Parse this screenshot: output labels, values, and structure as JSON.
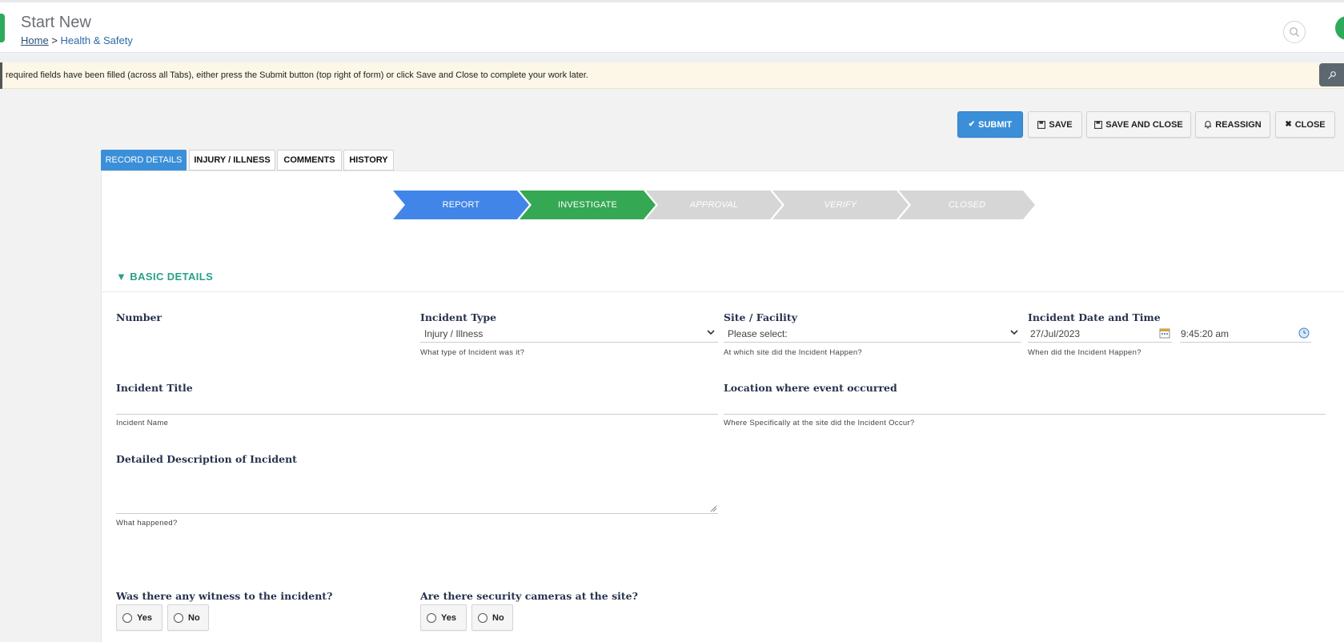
{
  "header": {
    "title": "Start New",
    "breadcrumb": {
      "home": "Home",
      "separator": ">",
      "current": "Health & Safety"
    }
  },
  "notice": {
    "text": "required fields have been filled (across all Tabs), either press the Submit button (top right of form) or click Save and Close to complete your work later."
  },
  "actions": {
    "submit": "SUBMIT",
    "save": "SAVE",
    "save_and_close": "SAVE AND CLOSE",
    "reassign": "REASSIGN",
    "close": "CLOSE"
  },
  "tabs": [
    {
      "label": "RECORD DETAILS",
      "active": true
    },
    {
      "label": "INJURY / ILLNESS",
      "active": false
    },
    {
      "label": "COMMENTS",
      "active": false
    },
    {
      "label": "HISTORY",
      "active": false
    }
  ],
  "stages": [
    {
      "label": "REPORT",
      "status": "complete",
      "color": "#4285e8"
    },
    {
      "label": "INVESTIGATE",
      "status": "current",
      "color": "#34a853"
    },
    {
      "label": "APPROVAL",
      "status": "pending",
      "color": "#d6d6d6"
    },
    {
      "label": "VERIFY",
      "status": "pending",
      "color": "#d6d6d6"
    },
    {
      "label": "CLOSED",
      "status": "pending",
      "color": "#d6d6d6"
    }
  ],
  "section": {
    "title": "BASIC DETAILS",
    "toggle": "▼"
  },
  "fields": {
    "number": {
      "label": "Number"
    },
    "incident_type": {
      "label": "Incident Type",
      "value": "Injury / Illness",
      "help": "What type of Incident was it?"
    },
    "site": {
      "label": "Site / Facility",
      "value": "Please select:",
      "help": "At which site did the Incident Happen?"
    },
    "date_time": {
      "label": "Incident Date and Time",
      "date": "27/Jul/2023",
      "time": "9:45:20 am",
      "help": "When did the Incident Happen?"
    },
    "title": {
      "label": "Incident Title",
      "value": "",
      "help": "Incident Name"
    },
    "location": {
      "label": "Location where event occurred",
      "value": "",
      "help": "Where Specifically at the site did the Incident Occur?"
    },
    "description": {
      "label": "Detailed Description of Incident",
      "value": "",
      "help": "What happened?"
    },
    "witness": {
      "label": "Was there any witness to the incident?",
      "yes": "Yes",
      "no": "No"
    },
    "cameras": {
      "label": "Are there security cameras at the site?",
      "yes": "Yes",
      "no": "No"
    }
  },
  "colors": {
    "accent": "#3a8fd8",
    "section": "#2a9f8a",
    "brand": "#2eaa5c"
  }
}
